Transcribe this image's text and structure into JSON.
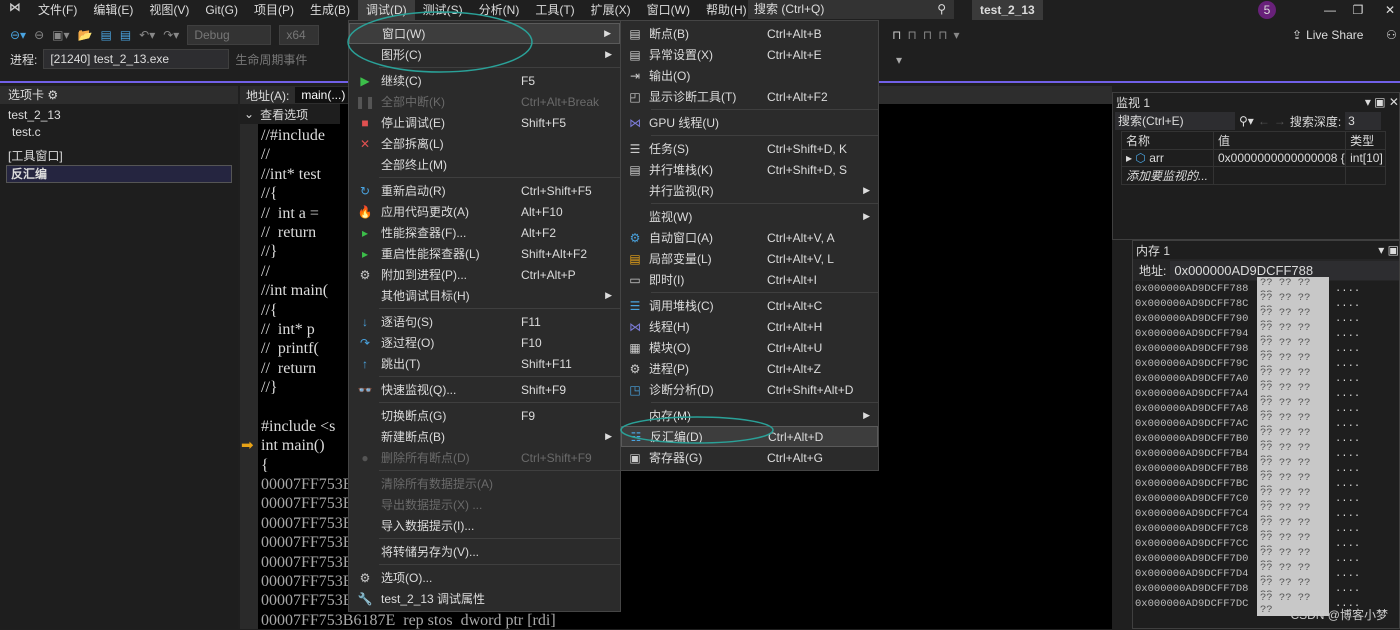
{
  "titlebar": {
    "menus": [
      "文件(F)",
      "编辑(E)",
      "视图(V)",
      "Git(G)",
      "项目(P)",
      "生成(B)",
      "调试(D)",
      "测试(S)",
      "分析(N)",
      "工具(T)",
      "扩展(X)",
      "窗口(W)",
      "帮助(H)"
    ],
    "search": "搜索 (Ctrl+Q)",
    "project": "test_2_13",
    "badge": "5"
  },
  "toolbar": {
    "config": "Debug",
    "platform": "x64",
    "live_share": "Live Share",
    "process_label": "进程:",
    "process": "[21240] test_2_13.exe",
    "lifecycle": "生命周期事件"
  },
  "left_panel": {
    "header": "选项卡",
    "items": [
      "test_2_13",
      "test.c"
    ],
    "group": "[工具窗口]",
    "selected": "反汇编"
  },
  "editor": {
    "address_label": "地址(A):",
    "address": "main(...)",
    "view_options": "查看选项",
    "lines": [
      "//#include",
      "//",
      "//int* test",
      "//{",
      "//  int a =",
      "//  return",
      "//}",
      "//",
      "//int main(",
      "//{",
      "//  int* p",
      "//  printf(",
      "//  return",
      "//}",
      "",
      "#include <s",
      "int main()",
      "{",
      "00007FF753B",
      "00007FF753B",
      "00007FF753B",
      "00007FF753B",
      "00007FF753B",
      "00007FF753B",
      "00007FF753B61879  mov       eax,0CCCCCCCCh",
      "00007FF753B6187E  rep stos  dword ptr [rdi]"
    ]
  },
  "debug_menu": [
    {
      "label": "窗口(W)",
      "submenu": true,
      "highlight": true
    },
    {
      "label": "图形(C)",
      "submenu": true
    },
    {
      "sep": true
    },
    {
      "label": "继续(C)",
      "shortcut": "F5",
      "icon": "play-icon"
    },
    {
      "label": "全部中断(K)",
      "shortcut": "Ctrl+Alt+Break",
      "disabled": true,
      "icon": "pause-icon"
    },
    {
      "label": "停止调试(E)",
      "shortcut": "Shift+F5",
      "icon": "stop-icon"
    },
    {
      "label": "全部拆离(L)",
      "icon": "detach-icon"
    },
    {
      "label": "全部终止(M)"
    },
    {
      "sep": true
    },
    {
      "label": "重新启动(R)",
      "shortcut": "Ctrl+Shift+F5",
      "icon": "restart-icon"
    },
    {
      "label": "应用代码更改(A)",
      "shortcut": "Alt+F10",
      "icon": "hot-reload-icon"
    },
    {
      "label": "性能探查器(F)...",
      "shortcut": "Alt+F2",
      "icon": "profiler-icon"
    },
    {
      "label": "重启性能探查器(L)",
      "shortcut": "Shift+Alt+F2",
      "icon": "profiler-restart-icon"
    },
    {
      "label": "附加到进程(P)...",
      "shortcut": "Ctrl+Alt+P",
      "icon": "attach-icon"
    },
    {
      "label": "其他调试目标(H)",
      "submenu": true
    },
    {
      "sep": true
    },
    {
      "label": "逐语句(S)",
      "shortcut": "F11",
      "icon": "step-into-icon"
    },
    {
      "label": "逐过程(O)",
      "shortcut": "F10",
      "icon": "step-over-icon"
    },
    {
      "label": "跳出(T)",
      "shortcut": "Shift+F11",
      "icon": "step-out-icon"
    },
    {
      "sep": true
    },
    {
      "label": "快速监视(Q)...",
      "shortcut": "Shift+F9",
      "icon": "glasses-icon"
    },
    {
      "sep": true
    },
    {
      "label": "切换断点(G)",
      "shortcut": "F9"
    },
    {
      "label": "新建断点(B)",
      "submenu": true
    },
    {
      "label": "删除所有断点(D)",
      "shortcut": "Ctrl+Shift+F9",
      "disabled": true,
      "icon": "breakpoint-icon"
    },
    {
      "sep": true
    },
    {
      "label": "清除所有数据提示(A)",
      "disabled": true
    },
    {
      "label": "导出数据提示(X) ...",
      "disabled": true
    },
    {
      "label": "导入数据提示(I)..."
    },
    {
      "sep": true
    },
    {
      "label": "将转储另存为(V)..."
    },
    {
      "sep": true
    },
    {
      "label": "选项(O)...",
      "icon": "gear-icon"
    },
    {
      "label": "test_2_13 调试属性",
      "icon": "wrench-icon"
    }
  ],
  "window_submenu": [
    {
      "label": "断点(B)",
      "shortcut": "Ctrl+Alt+B",
      "icon": "breakpoints-window-icon"
    },
    {
      "label": "异常设置(X)",
      "shortcut": "Ctrl+Alt+E",
      "icon": "exception-icon"
    },
    {
      "label": "输出(O)",
      "icon": "output-icon"
    },
    {
      "label": "显示诊断工具(T)",
      "shortcut": "Ctrl+Alt+F2",
      "icon": "diagnostics-icon"
    },
    {
      "sep": true
    },
    {
      "label": "GPU 线程(U)",
      "icon": "gpu-threads-icon"
    },
    {
      "sep": true
    },
    {
      "label": "任务(S)",
      "shortcut": "Ctrl+Shift+D, K",
      "icon": "tasks-icon"
    },
    {
      "label": "并行堆栈(K)",
      "shortcut": "Ctrl+Shift+D, S",
      "icon": "parallel-stacks-icon"
    },
    {
      "label": "并行监视(R)",
      "submenu": true
    },
    {
      "sep": true
    },
    {
      "label": "监视(W)",
      "submenu": true
    },
    {
      "label": "自动窗口(A)",
      "shortcut": "Ctrl+Alt+V, A",
      "icon": "autos-icon"
    },
    {
      "label": "局部变量(L)",
      "shortcut": "Ctrl+Alt+V, L",
      "icon": "locals-icon"
    },
    {
      "label": "即时(I)",
      "shortcut": "Ctrl+Alt+I",
      "icon": "immediate-icon"
    },
    {
      "sep": true
    },
    {
      "label": "调用堆栈(C)",
      "shortcut": "Ctrl+Alt+C",
      "icon": "call-stack-icon"
    },
    {
      "label": "线程(H)",
      "shortcut": "Ctrl+Alt+H",
      "icon": "threads-icon"
    },
    {
      "label": "模块(O)",
      "shortcut": "Ctrl+Alt+U",
      "icon": "modules-icon"
    },
    {
      "label": "进程(P)",
      "shortcut": "Ctrl+Alt+Z",
      "icon": "processes-icon"
    },
    {
      "label": "诊断分析(D)",
      "shortcut": "Ctrl+Shift+Alt+D",
      "icon": "diagnostic-analysis-icon"
    },
    {
      "sep": true
    },
    {
      "label": "内存(M)",
      "submenu": true
    },
    {
      "label": "反汇编(D)",
      "shortcut": "Ctrl+Alt+D",
      "highlight": true,
      "icon": "disassembly-icon"
    },
    {
      "label": "寄存器(G)",
      "shortcut": "Ctrl+Alt+G",
      "icon": "registers-icon"
    }
  ],
  "watch": {
    "title": "监视 1",
    "search": "搜索(Ctrl+E)",
    "depth_label": "搜索深度:",
    "depth": "3",
    "columns": [
      "名称",
      "值",
      "类型"
    ],
    "rows": [
      {
        "name": "arr",
        "value": "0x0000000000000008 {...",
        "type": "int[10]"
      }
    ],
    "add_hint": "添加要监视的..."
  },
  "memory": {
    "title": "内存 1",
    "address_label": "地址:",
    "address": "0x000000AD9DCFF788",
    "rows": [
      "0x000000AD9DCFF788",
      "0x000000AD9DCFF78C",
      "0x000000AD9DCFF790",
      "0x000000AD9DCFF794",
      "0x000000AD9DCFF798",
      "0x000000AD9DCFF79C",
      "0x000000AD9DCFF7A0",
      "0x000000AD9DCFF7A4",
      "0x000000AD9DCFF7A8",
      "0x000000AD9DCFF7AC",
      "0x000000AD9DCFF7B0",
      "0x000000AD9DCFF7B4",
      "0x000000AD9DCFF7B8",
      "0x000000AD9DCFF7BC",
      "0x000000AD9DCFF7C0",
      "0x000000AD9DCFF7C4",
      "0x000000AD9DCFF7C8",
      "0x000000AD9DCFF7CC",
      "0x000000AD9DCFF7D0",
      "0x000000AD9DCFF7D4",
      "0x000000AD9DCFF7D8",
      "0x000000AD9DCFF7DC"
    ],
    "bytes": "?? ?? ?? ??",
    "chars": "...."
  },
  "watermark": "CSDN @博客小梦",
  "colors": {
    "accent": "#7160e8",
    "annotation": "#2aa198",
    "arrow": "#e8a317"
  }
}
